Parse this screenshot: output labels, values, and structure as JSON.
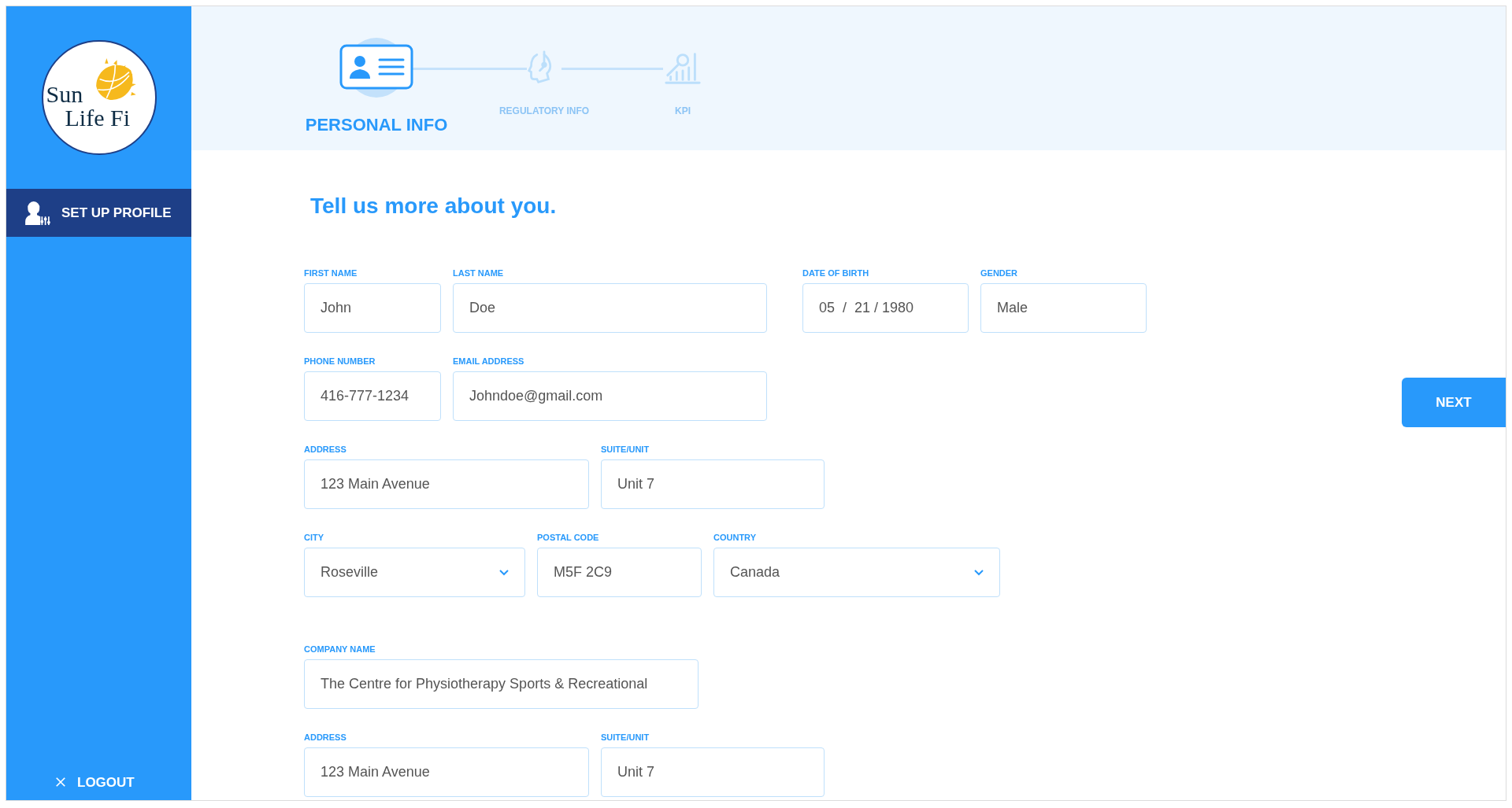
{
  "sidebar": {
    "logo": {
      "line_1": "Sun",
      "line_2": "Life Fi"
    },
    "items": [
      {
        "label": "SET UP PROFILE",
        "kind": "profile",
        "selected": true
      }
    ],
    "logout": {
      "label": "LOGOUT"
    }
  },
  "stepper": {
    "steps": [
      {
        "label": "PERSONAL INFO",
        "kind": "id-card",
        "selected": true
      },
      {
        "label": "REGULATORY INFO",
        "kind": "headset",
        "selected": false
      },
      {
        "label": "KPI",
        "kind": "chart",
        "selected": false
      }
    ]
  },
  "form": {
    "title": "Tell us more about you.",
    "sections": [
      {
        "rows": [
          [
            {
              "label": "FIRST NAME",
              "value": "John",
              "kind": "text"
            },
            {
              "label": "LAST NAME",
              "value": "Doe",
              "kind": "text"
            },
            {
              "label": "DATE OF BIRTH",
              "value": "05  /  21 / 1980",
              "kind": "text"
            },
            {
              "label": "GENDER",
              "value": "Male",
              "kind": "text"
            }
          ],
          [
            {
              "label": "PHONE NUMBER",
              "value": "416-777-1234",
              "kind": "text"
            },
            {
              "label": "EMAIL ADDRESS",
              "value": "Johndoe@gmail.com",
              "kind": "text"
            }
          ],
          [
            {
              "label": "ADDRESS",
              "value": "123 Main Avenue",
              "kind": "text"
            },
            {
              "label": "SUITE/UNIT",
              "value": "Unit 7",
              "kind": "text"
            }
          ],
          [
            {
              "label": "CITY",
              "value": "Roseville",
              "kind": "select"
            },
            {
              "label": "POSTAL CODE",
              "value": "M5F 2C9",
              "kind": "text"
            },
            {
              "label": "COUNTRY",
              "value": "Canada",
              "kind": "select"
            }
          ]
        ]
      },
      {
        "rows": [
          [
            {
              "label": "COMPANY NAME",
              "value": "The Centre for Physiotherapy Sports & Recreational",
              "kind": "text"
            }
          ],
          [
            {
              "label": "ADDRESS",
              "value": "123 Main Avenue",
              "kind": "text"
            },
            {
              "label": "SUITE/UNIT",
              "value": "Unit 7",
              "kind": "text"
            }
          ]
        ]
      }
    ]
  },
  "next_button": {
    "label": "NEXT"
  }
}
